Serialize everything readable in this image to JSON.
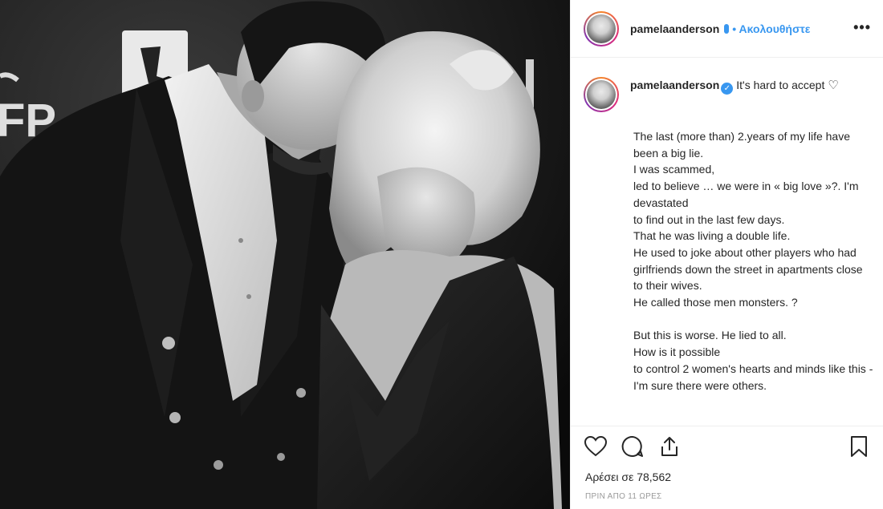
{
  "post": {
    "username": "pamelaanderson",
    "follow_label": "• Ακολουθήστε",
    "more_label": "•••",
    "caption_head": "It's hard to accept",
    "caption_heart": "♡",
    "caption_body": "The last (more than) 2.years of my life have been a big lie.\nI was scammed,\nled to believe … we were in « big love »?. I'm devastated\nto find out in the last few days.\nThat he was living a double life.\nHe used to joke about other players who had girlfriends down the street in apartments close to their wives.\nHe called those men monsters. ?\n\nBut this is worse. He lied to all.\nHow is it possible\nto control 2 women's hearts and minds like this -\nI'm sure there were others.",
    "likes_label": "Αρέσει σε 78,562",
    "timestamp": "ΠΡΙΝ ΑΠΟ 11 ΩΡΕΣ"
  },
  "photo": {
    "signage_letters": "FP",
    "signage_bottom": "N"
  },
  "icons": [
    "heart-icon",
    "comment-icon",
    "share-icon",
    "bookmark-icon"
  ],
  "colors": {
    "accent": "#3897f0",
    "text": "#262626",
    "muted": "#999999",
    "border": "#efefef"
  }
}
